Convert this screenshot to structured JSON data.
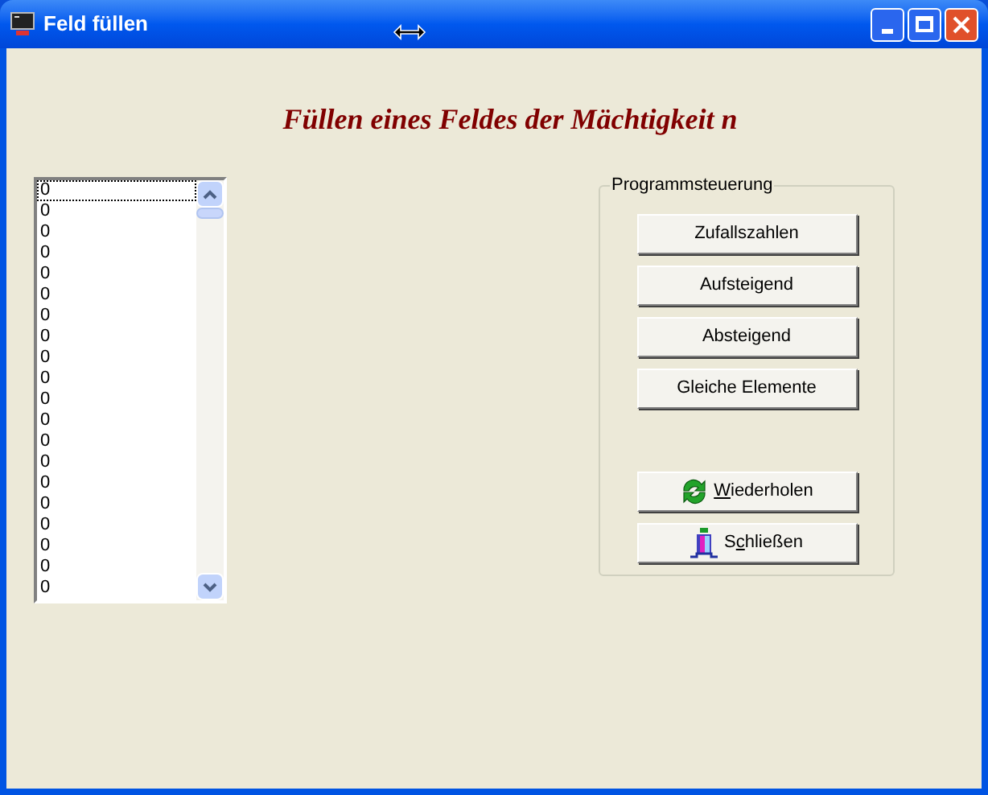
{
  "window": {
    "title": "Feld füllen"
  },
  "heading": "Füllen eines Feldes der Mächtigkeit n",
  "list": {
    "items": [
      {
        "text": "0",
        "selected": true
      },
      {
        "text": "0",
        "selected": false
      },
      {
        "text": "0",
        "selected": false
      },
      {
        "text": "0",
        "selected": false
      },
      {
        "text": "0",
        "selected": false
      },
      {
        "text": "0",
        "selected": false
      },
      {
        "text": "0",
        "selected": false
      },
      {
        "text": "0",
        "selected": false
      },
      {
        "text": "0",
        "selected": false
      },
      {
        "text": "0",
        "selected": false
      },
      {
        "text": "0",
        "selected": false
      },
      {
        "text": "0",
        "selected": false
      },
      {
        "text": "0",
        "selected": false
      },
      {
        "text": "0",
        "selected": false
      },
      {
        "text": "0",
        "selected": false
      },
      {
        "text": "0",
        "selected": false
      },
      {
        "text": "0",
        "selected": false
      },
      {
        "text": "0",
        "selected": false
      },
      {
        "text": "0",
        "selected": false
      },
      {
        "text": "0",
        "selected": false
      }
    ]
  },
  "group": {
    "title": "Programmsteuerung",
    "buttons": [
      {
        "kind": "text",
        "label": [
          {
            "text": "Zufallszahlen",
            "underlined": false
          }
        ]
      },
      {
        "kind": "text",
        "label": [
          {
            "text": "Aufsteigend",
            "underlined": false
          }
        ]
      },
      {
        "kind": "text",
        "label": [
          {
            "text": "Absteigend",
            "underlined": false
          }
        ]
      },
      {
        "kind": "text",
        "label": [
          {
            "text": "Gleiche Elemente",
            "underlined": false
          }
        ]
      },
      {
        "kind": "refresh",
        "label": [
          {
            "text": "W",
            "underlined": true
          },
          {
            "text": "iederholen",
            "underlined": false
          }
        ]
      },
      {
        "kind": "exit",
        "label": [
          {
            "text": "S",
            "underlined": false
          },
          {
            "text": "c",
            "underlined": true
          },
          {
            "text": "hließen",
            "underlined": false
          }
        ]
      }
    ]
  }
}
